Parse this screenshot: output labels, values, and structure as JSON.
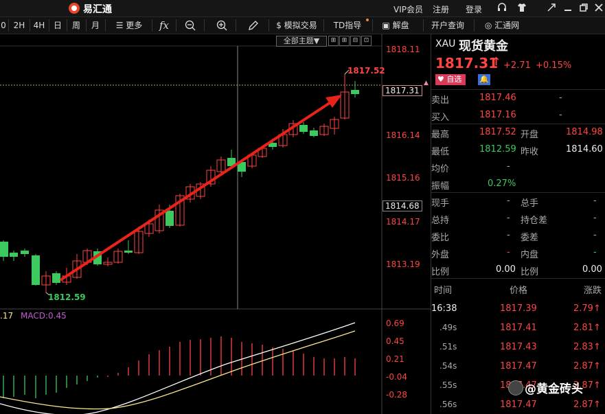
{
  "titlebar": {
    "app_name": "易汇通",
    "links": [
      "VIP会员",
      "注册",
      "登录"
    ],
    "icons": [
      "headset-icon",
      "shirt-icon",
      "collapse-icon",
      "minimize-icon",
      "maximize-icon",
      "close-icon"
    ]
  },
  "toolbar": {
    "periods": [
      "0",
      "2H",
      "4H",
      "日",
      "周",
      "月"
    ],
    "more_label": "更多",
    "fx_label": "fx",
    "sim_trade_label": "模拟交易",
    "td_label": "TD指导",
    "review_label": "解盘",
    "open_account_label": "开户查询",
    "huitong_label": "汇通网"
  },
  "chart": {
    "theme_button": "全部主题▼",
    "price_axis": [
      "1818.11",
      "1816.14",
      "1815.16",
      "1814.17",
      "1813.19"
    ],
    "current_price_tag": "1817.31",
    "crosshair_price_tag": "1814.68",
    "high_label": "1817.52",
    "low_label": "1812.59",
    "macd_prefix": ".17",
    "macd_label": "MACD:0.45",
    "macd_axis": [
      "0.69",
      "0.45",
      "0.21",
      "-0.04",
      "-0.28"
    ]
  },
  "quote": {
    "symbol": "XAU",
    "name": "现货黄金",
    "price": "1817.31",
    "arrow": "↑",
    "change": "+2.71",
    "change_pct": "+0.15%",
    "watch_label": "自选",
    "sell_label": "卖出",
    "sell": "1817.46",
    "sell_vol": "-",
    "buy_label": "买入",
    "buy": "1817.16",
    "buy_vol": "-",
    "high_label": "最高",
    "high": "1817.52",
    "open_label": "开盘",
    "open": "1814.98",
    "low_label": "最低",
    "low": "1812.59",
    "prev_label": "昨收",
    "prev": "1814.60",
    "avg_label": "均价",
    "avg": "-",
    "amp_label": "振幅",
    "amp": "0.27%",
    "now_hand_label": "现手",
    "now_hand": "-",
    "total_hand_label": "总手",
    "total_hand": "-",
    "total_hold_label": "总持",
    "total_hold": "-",
    "hold_diff_label": "持仓差",
    "hold_diff": "-",
    "commit_ratio_label": "委比",
    "commit_ratio": "-",
    "commit_diff_label": "委差",
    "commit_diff": "-",
    "outer_label": "外盘",
    "outer": "-",
    "inner_label": "内盘",
    "inner": "-",
    "ratio1_label": "比例",
    "ratio1": "0.00",
    "ratio2_label": "比例",
    "ratio2": "0.00"
  },
  "ticks": {
    "headers": [
      "时间",
      "价格",
      "涨跌"
    ],
    "rows": [
      {
        "time": "16:38",
        "price": "1817.39",
        "change": "2.79↑"
      },
      {
        "time": ".49s",
        "price": "1817.41",
        "change": "2.81↑"
      },
      {
        "time": ".51s",
        "price": "1817.43",
        "change": "2.83↑"
      },
      {
        "time": ".54s",
        "price": "1817.47",
        "change": "2.87↑"
      },
      {
        "time": ".55s",
        "price": "1817.47",
        "change": "2.87↑"
      },
      {
        "time": ".56s",
        "price": "1817.47",
        "change": "2.87↑"
      }
    ]
  },
  "watermark": "@黄金砖头",
  "colors": {
    "up": "#ff4444",
    "down": "#3cc95d",
    "arrow": "#e8231a",
    "macd_line_a": "#ffffff",
    "macd_line_b": "#ffe68a"
  }
}
